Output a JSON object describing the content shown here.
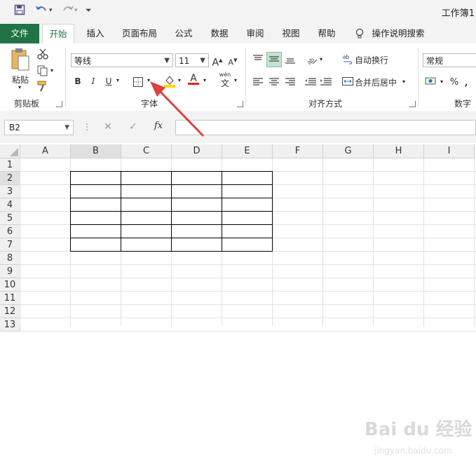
{
  "window": {
    "title": "工作簿1"
  },
  "tabs": [
    "文件",
    "开始",
    "插入",
    "页面布局",
    "公式",
    "数据",
    "审阅",
    "视图",
    "帮助"
  ],
  "tell_me": "操作说明搜索",
  "clipboard": {
    "paste_label": "粘贴",
    "group_label": "剪贴板"
  },
  "font": {
    "name": "等线",
    "size": "11",
    "group_label": "字体",
    "bold": "B",
    "italic": "I",
    "underline": "U",
    "grow": "A",
    "shrink": "A",
    "color_glyph": "A",
    "phonetic": "wén"
  },
  "alignment": {
    "wrap_text": "自动换行",
    "merge_center": "合并后居中",
    "group_label": "对齐方式"
  },
  "number": {
    "format": "常规",
    "percent": "%",
    "group_label": "数字"
  },
  "formula_bar": {
    "name_box": "B2",
    "fx": "fx",
    "cancel": "✕",
    "enter": "✓"
  },
  "grid": {
    "columns": [
      "A",
      "B",
      "C",
      "D",
      "E",
      "F",
      "G",
      "H",
      "I"
    ],
    "rows": [
      "1",
      "2",
      "3",
      "4",
      "5",
      "6",
      "7",
      "8",
      "9",
      "10",
      "11",
      "12",
      "13"
    ]
  },
  "watermark": {
    "brand": "Bai du 经验",
    "url": "jingyan.baidu.com"
  },
  "colors": {
    "accent": "#217346",
    "arrow": "#e04040",
    "fill_highlight": "#ffd700",
    "font_color": "#e02020"
  }
}
